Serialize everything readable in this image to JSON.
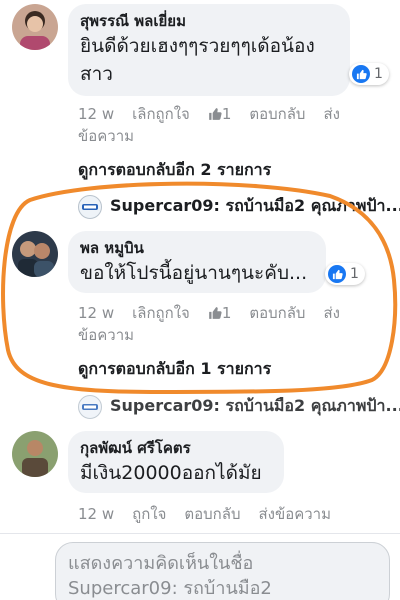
{
  "comments": [
    {
      "author": "สุพรรณี พลเยี่ยม",
      "text_line1": "ยินดีด้วยเฮงๆๆรวยๆๆเด้อน้อง",
      "text_line2": "สาว",
      "reaction_count": "1",
      "time": "12 w",
      "unlike": "เลิกถูกใจ",
      "like_count": "1",
      "reply": "ตอบกลับ",
      "message_line1": "ส่ง",
      "message_line2": "ข้อความ",
      "more_replies": "ดูการตอบกลับอีก 2 รายการ",
      "page_reply": "Supercar09: รถบ้านมือ2 คุณภาพป้า..."
    },
    {
      "author": "พล หมูบิน",
      "text_line1": "ขอให้โปรนี้อยู่นานๆนะคับ...",
      "reaction_count": "1",
      "time": "12 w",
      "unlike": "เลิกถูกใจ",
      "like_count": "1",
      "reply": "ตอบกลับ",
      "message_line1": "ส่ง",
      "message_line2": "ข้อความ",
      "more_replies": "ดูการตอบกลับอีก 1 รายการ",
      "page_reply": "Supercar09: รถบ้านมือ2 คุณภาพป้า..."
    },
    {
      "author": "กุลพัฒน์ ศรีโคตร",
      "text_line1": "มีเงิน20000ออกได้มัย",
      "time": "12 w",
      "like": "ถูกใจ",
      "reply": "ตอบกลับ",
      "message": "ส่งข้อความ"
    }
  ],
  "composer": {
    "line1": "แสดงความคิดเห็นในชื่อ",
    "line2": "Supercar09: รถบ้านมือ2"
  },
  "colors": {
    "highlight": "#f08a2c",
    "like_blue": "#1877f2"
  }
}
